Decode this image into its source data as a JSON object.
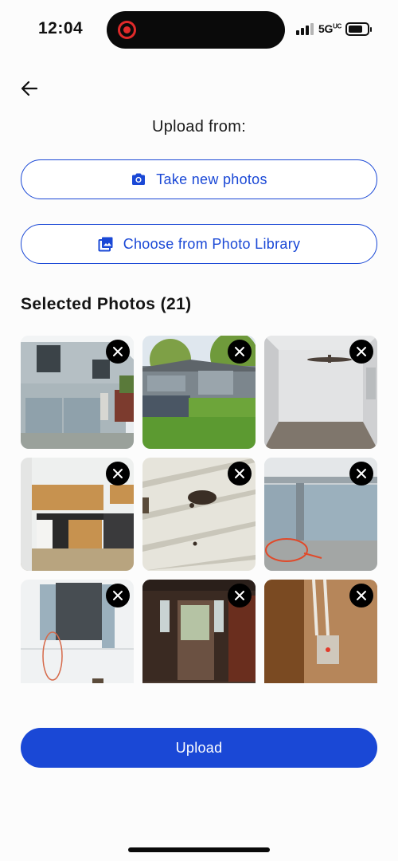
{
  "status_bar": {
    "time": "12:04",
    "network": "5G",
    "network_sup": "UC",
    "recording_indicator_color": "#e02a2a"
  },
  "header": {
    "back_icon": "arrow-left-icon"
  },
  "upload_from": {
    "label": "Upload from:",
    "take_photos_label": "Take new photos",
    "take_photos_icon": "camera-icon",
    "library_label": "Choose from Photo Library",
    "library_icon": "photo-library-icon"
  },
  "selected": {
    "title": "Selected Photos (21)",
    "count": 21,
    "remove_icon": "close-icon",
    "photos": [
      {
        "subject": "house-exterior-garage"
      },
      {
        "subject": "house-backyard"
      },
      {
        "subject": "empty-room-ceiling-fan"
      },
      {
        "subject": "kitchen-cabinets"
      },
      {
        "subject": "damaged-siding"
      },
      {
        "subject": "garage-door-marked"
      },
      {
        "subject": "exterior-wall-marked"
      },
      {
        "subject": "front-door-interior"
      },
      {
        "subject": "wall-outlet-wires"
      }
    ]
  },
  "actions": {
    "upload_label": "Upload"
  },
  "colors": {
    "accent": "#1a48d6",
    "background": "#fcfcfc",
    "text": "#111111"
  }
}
